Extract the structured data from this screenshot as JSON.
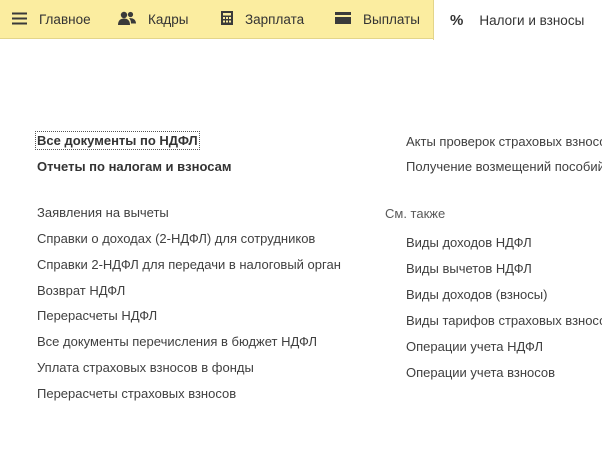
{
  "tabs": [
    {
      "label": "Главное",
      "icon": "menu-icon"
    },
    {
      "label": "Кадры",
      "icon": "people-icon"
    },
    {
      "label": "Зарплата",
      "icon": "calculator-icon"
    },
    {
      "label": "Выплаты",
      "icon": "wallet-icon"
    },
    {
      "label": "Налоги и взносы",
      "icon": "percent-icon",
      "active": true
    }
  ],
  "left_column": {
    "primary": [
      "Все документы по НДФЛ",
      "Отчеты по налогам и взносам"
    ],
    "items": [
      "Заявления на вычеты",
      "Справки о доходах (2-НДФЛ) для сотрудников",
      "Справки 2-НДФЛ для передачи в налоговый орган",
      "Возврат НДФЛ",
      "Перерасчеты НДФЛ",
      "Все документы перечисления в бюджет НДФЛ",
      "Уплата страховых взносов в фонды",
      "Перерасчеты страховых взносов"
    ]
  },
  "right_column": {
    "items": [
      "Акты проверок страховых взносо",
      "Получение возмещений пособий"
    ],
    "see_also_title": "См. также",
    "see_also": [
      "Виды доходов НДФЛ",
      "Виды вычетов НДФЛ",
      "Виды доходов (взносы)",
      "Виды тарифов страховых взносо",
      "Операции учета НДФЛ",
      "Операции учета взносов"
    ]
  },
  "colors": {
    "topbar": "#fbeda0",
    "text": "#333333"
  }
}
